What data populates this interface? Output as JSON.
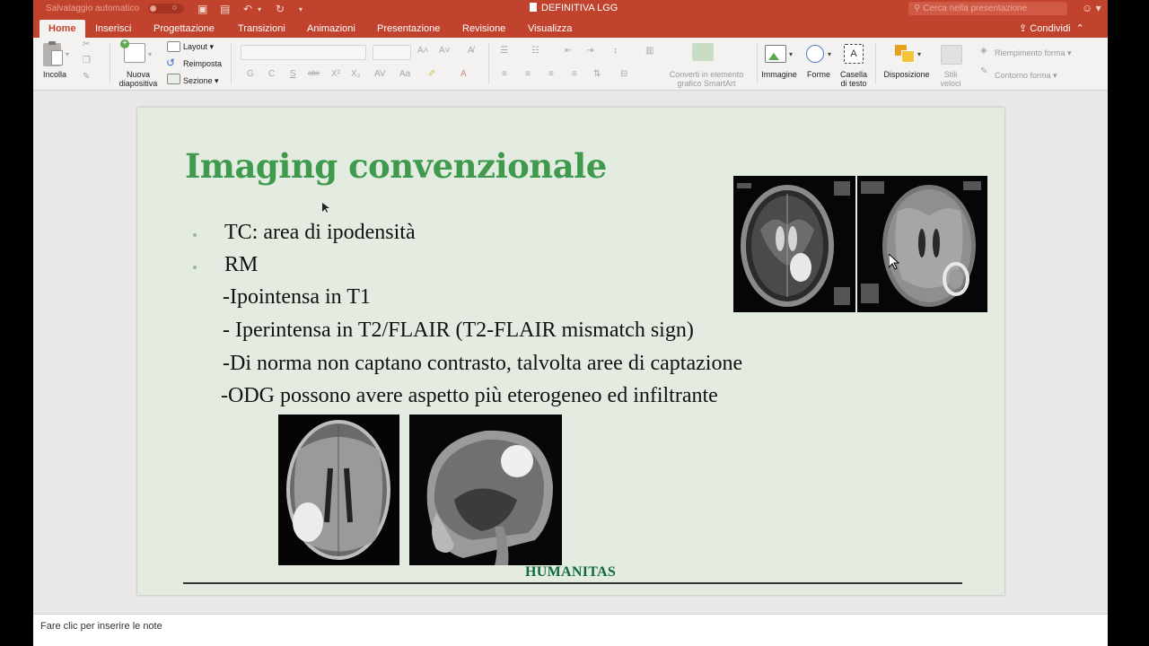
{
  "titlebar": {
    "autosave_label": "Salvataggio automatico",
    "autosave_state": "o",
    "doc_title": "DEFINITIVA LGG",
    "search_placeholder": "Cerca nella presentazione"
  },
  "tabs": [
    "Home",
    "Inserisci",
    "Progettazione",
    "Transizioni",
    "Animazioni",
    "Presentazione",
    "Revisione",
    "Visualizza"
  ],
  "share_label": "Condividi",
  "ribbon": {
    "paste": "Incolla",
    "new_slide_line1": "Nuova",
    "new_slide_line2": "diapositiva",
    "layout": "Layout",
    "reset": "Reimposta",
    "section": "Sezione",
    "smartart_line1": "Converti in elemento",
    "smartart_line2": "grafico SmartArt",
    "image": "Immagine",
    "shapes": "Forme",
    "textbox_line1": "Casella",
    "textbox_line2": "di testo",
    "arrange": "Disposizione",
    "quick_styles_line1": "Stili",
    "quick_styles_line2": "veloci",
    "shape_fill": "Riempimento forma",
    "shape_outline": "Contorno forma"
  },
  "slide": {
    "title": "Imaging convenzionale",
    "bullets": [
      "TC: area di ipodensità",
      "RM"
    ],
    "lines": [
      "-Ipointensa in T1",
      "- Iperintensa in T2/FLAIR (T2-FLAIR mismatch sign)",
      "-Di norma non captano contrasto, talvolta aree di captazione",
      "-ODG possono avere aspetto più eterogeneo ed infiltrante"
    ],
    "footer": "HUMANITAS"
  },
  "notes_placeholder": "Fare clic per inserire le note",
  "colors": {
    "accent": "#c1432e",
    "title_green": "#3f9a4e",
    "footer_green": "#0d6a3d",
    "slide_bg": "#e4ebe0"
  }
}
